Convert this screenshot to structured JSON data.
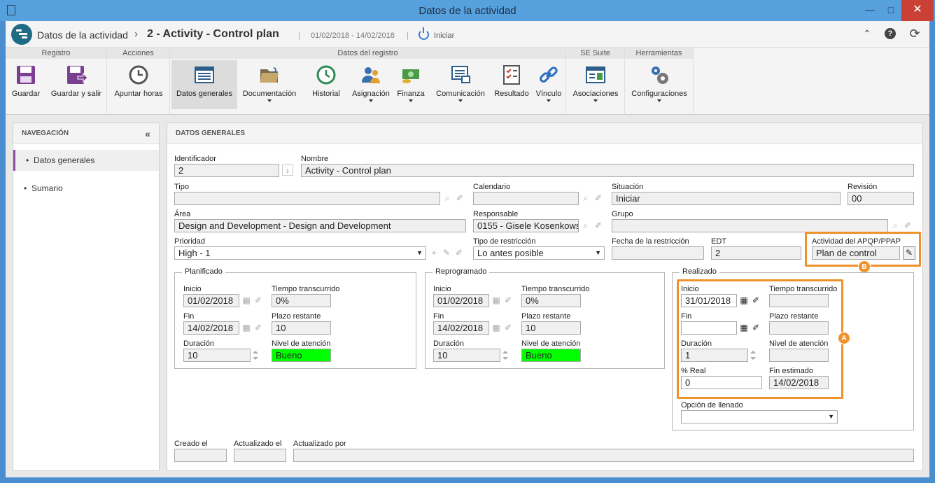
{
  "window": {
    "title": "Datos de la actividad",
    "minimize": "—",
    "maximize": "□",
    "close": "✕"
  },
  "header": {
    "app_title": "Datos de la actividad",
    "separator": "›",
    "record_title": "2 - Activity - Control plan",
    "pipe": "|",
    "dates": "01/02/2018 - 14/02/2018",
    "status": "Iniciar",
    "icons": [
      "collapse-up-icon",
      "help-icon",
      "refresh-icon"
    ]
  },
  "ribbon": {
    "groups": [
      {
        "title": "Registro",
        "buttons": [
          {
            "label": "Guardar",
            "icon": "save-icon"
          },
          {
            "label": "Guardar y salir",
            "icon": "save-exit-icon"
          }
        ]
      },
      {
        "title": "Acciones",
        "buttons": [
          {
            "label": "Apuntar horas",
            "icon": "clock-icon"
          }
        ]
      },
      {
        "title": "Datos del registro",
        "buttons": [
          {
            "label": "Datos generales",
            "icon": "form-icon",
            "active": true
          },
          {
            "label": "Documentación",
            "icon": "folder-icon",
            "dropdown": true
          },
          {
            "label": "Historial",
            "icon": "history-icon"
          },
          {
            "label": "Asignación",
            "icon": "users-icon",
            "dropdown": true
          },
          {
            "label": "Finanza",
            "icon": "money-icon",
            "dropdown": true
          },
          {
            "label": "Comunicación",
            "icon": "chat-icon",
            "dropdown": true
          },
          {
            "label": "Resultado",
            "icon": "checklist-icon"
          },
          {
            "label": "Vínculo",
            "icon": "link-icon",
            "dropdown": true
          }
        ]
      },
      {
        "title": "SE Suite",
        "buttons": [
          {
            "label": "Asociaciones",
            "icon": "associations-icon",
            "dropdown": true
          }
        ]
      },
      {
        "title": "Herramientas",
        "buttons": [
          {
            "label": "Configuraciones",
            "icon": "gears-icon",
            "dropdown": true
          }
        ]
      }
    ]
  },
  "nav": {
    "title": "NAVEGACIÓN",
    "collapse": "«",
    "items": [
      {
        "label": "Datos generales",
        "active": true
      },
      {
        "label": "Sumario"
      }
    ]
  },
  "main": {
    "title": "DATOS GENERALES",
    "identificador": {
      "label": "Identificador",
      "value": "2"
    },
    "nombre": {
      "label": "Nombre",
      "value": "Activity - Control plan"
    },
    "tipo": {
      "label": "Tipo",
      "value": ""
    },
    "calendario": {
      "label": "Calendario",
      "value": ""
    },
    "situacion": {
      "label": "Situación",
      "value": "Iniciar"
    },
    "revision": {
      "label": "Revisión",
      "value": "00"
    },
    "area": {
      "label": "Área",
      "value": "Design and Development - Design and Development"
    },
    "responsable": {
      "label": "Responsable",
      "value": "0155 - Gisele Kosenkows"
    },
    "grupo": {
      "label": "Grupo",
      "value": ""
    },
    "prioridad": {
      "label": "Prioridad",
      "value": "High - 1"
    },
    "tipo_restriccion": {
      "label": "Tipo de restricción",
      "value": "Lo antes posible"
    },
    "fecha_restriccion": {
      "label": "Fecha de la restricción",
      "value": ""
    },
    "edt": {
      "label": "EDT",
      "value": "2"
    },
    "apqp": {
      "label": "Actividad del APQP/PPAP",
      "value": "Plan de control"
    },
    "planificado": {
      "legend": "Planificado",
      "inicio_label": "Inicio",
      "inicio": "01/02/2018",
      "tiempo_label": "Tiempo transcurrido",
      "tiempo": "0%",
      "fin_label": "Fin",
      "fin": "14/02/2018",
      "plazo_label": "Plazo restante",
      "plazo": "10",
      "duracion_label": "Duración",
      "duracion": "10",
      "nivel_label": "Nivel de atención",
      "nivel": "Bueno"
    },
    "reprogramado": {
      "legend": "Reprogramado",
      "inicio_label": "Inicio",
      "inicio": "01/02/2018",
      "tiempo_label": "Tiempo transcurrido",
      "tiempo": "0%",
      "fin_label": "Fin",
      "fin": "14/02/2018",
      "plazo_label": "Plazo restante",
      "plazo": "10",
      "duracion_label": "Duración",
      "duracion": "10",
      "nivel_label": "Nivel de atención",
      "nivel": "Bueno"
    },
    "realizado": {
      "legend": "Realizado",
      "inicio_label": "Inicio",
      "inicio": "31/01/2018",
      "tiempo_label": "Tiempo transcurrido",
      "tiempo": "",
      "fin_label": "Fin",
      "fin": "",
      "plazo_label": "Plazo restante",
      "plazo": "",
      "duracion_label": "Duración",
      "duracion": "1",
      "nivel_label": "Nivel de atención",
      "nivel": "",
      "real_label": "% Real",
      "real": "0",
      "fin_est_label": "Fin estimado",
      "fin_est": "14/02/2018",
      "opcion_label": "Opción de llenado",
      "opcion": ""
    },
    "creado": {
      "label": "Creado el",
      "value": ""
    },
    "actualizado": {
      "label": "Actualizado el",
      "value": ""
    },
    "actualizado_por": {
      "label": "Actualizado por",
      "value": ""
    },
    "badges": {
      "a": "A",
      "b": "B"
    },
    "highlight_color": "#f0922b",
    "good_color": "#00ff00"
  }
}
